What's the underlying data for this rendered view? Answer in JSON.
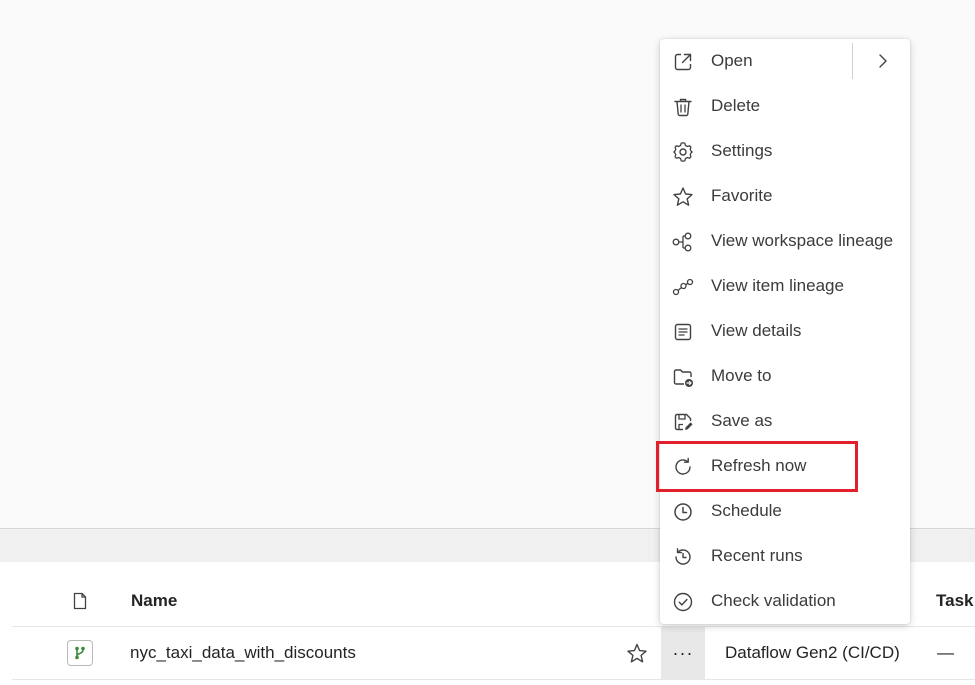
{
  "context_menu": {
    "items": [
      {
        "label": "Open",
        "icon": "open-external-icon"
      },
      {
        "label": "Delete",
        "icon": "trash-icon"
      },
      {
        "label": "Settings",
        "icon": "gear-icon"
      },
      {
        "label": "Favorite",
        "icon": "star-icon"
      },
      {
        "label": "View workspace lineage",
        "icon": "workspace-lineage-icon"
      },
      {
        "label": "View item lineage",
        "icon": "item-lineage-icon"
      },
      {
        "label": "View details",
        "icon": "details-icon"
      },
      {
        "label": "Move to",
        "icon": "folder-move-icon"
      },
      {
        "label": "Save as",
        "icon": "save-as-icon"
      },
      {
        "label": "Refresh now",
        "icon": "refresh-icon"
      },
      {
        "label": "Schedule",
        "icon": "clock-icon"
      },
      {
        "label": "Recent runs",
        "icon": "history-icon"
      },
      {
        "label": "Check validation",
        "icon": "check-circle-icon"
      }
    ],
    "highlighted_item": "Refresh now",
    "highlight_color": "#e0202a"
  },
  "table": {
    "columns": {
      "name": "Name",
      "task": "Task"
    },
    "rows": [
      {
        "name": "nyc_taxi_data_with_discounts",
        "type": "Dataflow Gen2 (CI/CD)",
        "task": "—",
        "more": "···"
      }
    ]
  },
  "colors": {
    "item_icon_green": "#3a8a3a",
    "more_button_bg": "#e8e8e8"
  }
}
